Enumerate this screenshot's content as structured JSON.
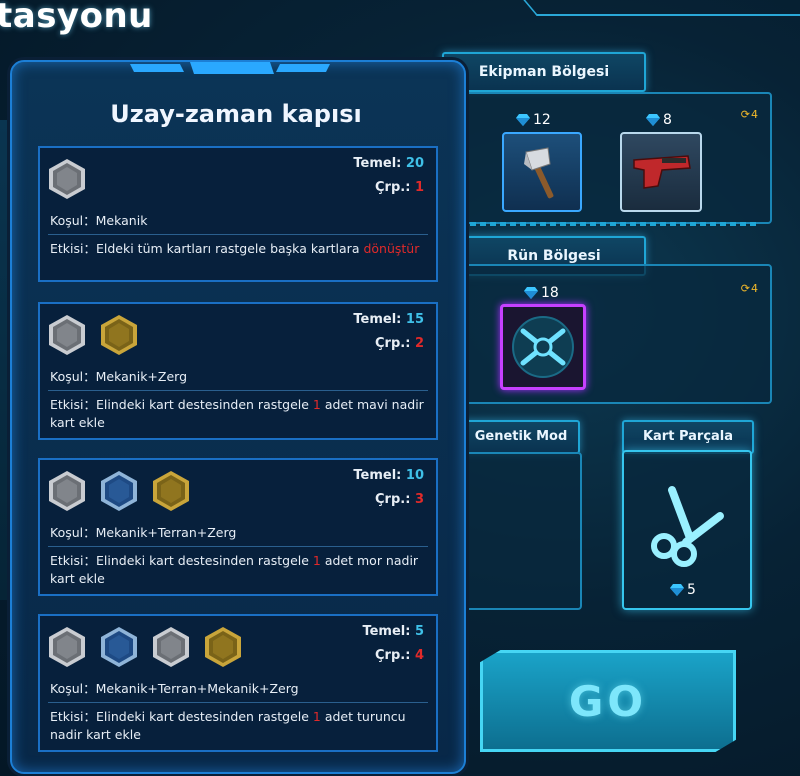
{
  "page": {
    "title": "tasyonu"
  },
  "modal": {
    "title": "Uzay-zaman kapısı",
    "labels": {
      "temel": "Temel:",
      "crp": "Çrp.:",
      "kosul": "Koşul：",
      "etkisi": "Etkisi："
    },
    "cards": [
      {
        "hexes": [
          "gray"
        ],
        "temel": "20",
        "crp": "1",
        "condition": "Mekanik",
        "effect_parts": [
          "Eldeki tüm kartları rastgele başka kartlara ",
          "dönüştür",
          ""
        ]
      },
      {
        "hexes": [
          "gray",
          "gold"
        ],
        "temel": "15",
        "crp": "2",
        "condition": "Mekanik+Zerg",
        "effect_parts": [
          "Elindeki kart destesinden rastgele ",
          "1",
          " adet mavi nadir kart ekle"
        ]
      },
      {
        "hexes": [
          "gray",
          "blue",
          "gold"
        ],
        "temel": "10",
        "crp": "3",
        "condition": "Mekanik+Terran+Zerg",
        "effect_parts": [
          "Elindeki kart destesinden rastgele ",
          "1",
          " adet mor nadir kart ekle"
        ]
      },
      {
        "hexes": [
          "gray",
          "blue",
          "gray",
          "gold"
        ],
        "temel": "5",
        "crp": "4",
        "condition": "Mekanik+Terran+Mekanik+Zerg",
        "effect_parts": [
          "Elindeki kart destesinden rastgele ",
          "1",
          " adet turuncu nadir kart ekle"
        ]
      }
    ]
  },
  "equipment": {
    "label": "Ekipman Bölgesi",
    "refresh": "4",
    "items": [
      {
        "icon": "axe-icon",
        "cost": "12"
      },
      {
        "icon": "pistol-icon",
        "cost": "8"
      }
    ]
  },
  "rune": {
    "label": "Rün Bölgesi",
    "refresh": "4",
    "items": [
      {
        "icon": "rune-emblem-icon",
        "cost": "18"
      }
    ]
  },
  "genetic": {
    "label": "Genetik Mod"
  },
  "shred": {
    "label": "Kart Parçala",
    "cost": "5"
  },
  "go": {
    "label": "GO"
  },
  "colors": {
    "accent": "#1fa6d6",
    "temel": "#3fc0e8",
    "crp": "#e02a2a",
    "refresh": "#f2b92a"
  }
}
